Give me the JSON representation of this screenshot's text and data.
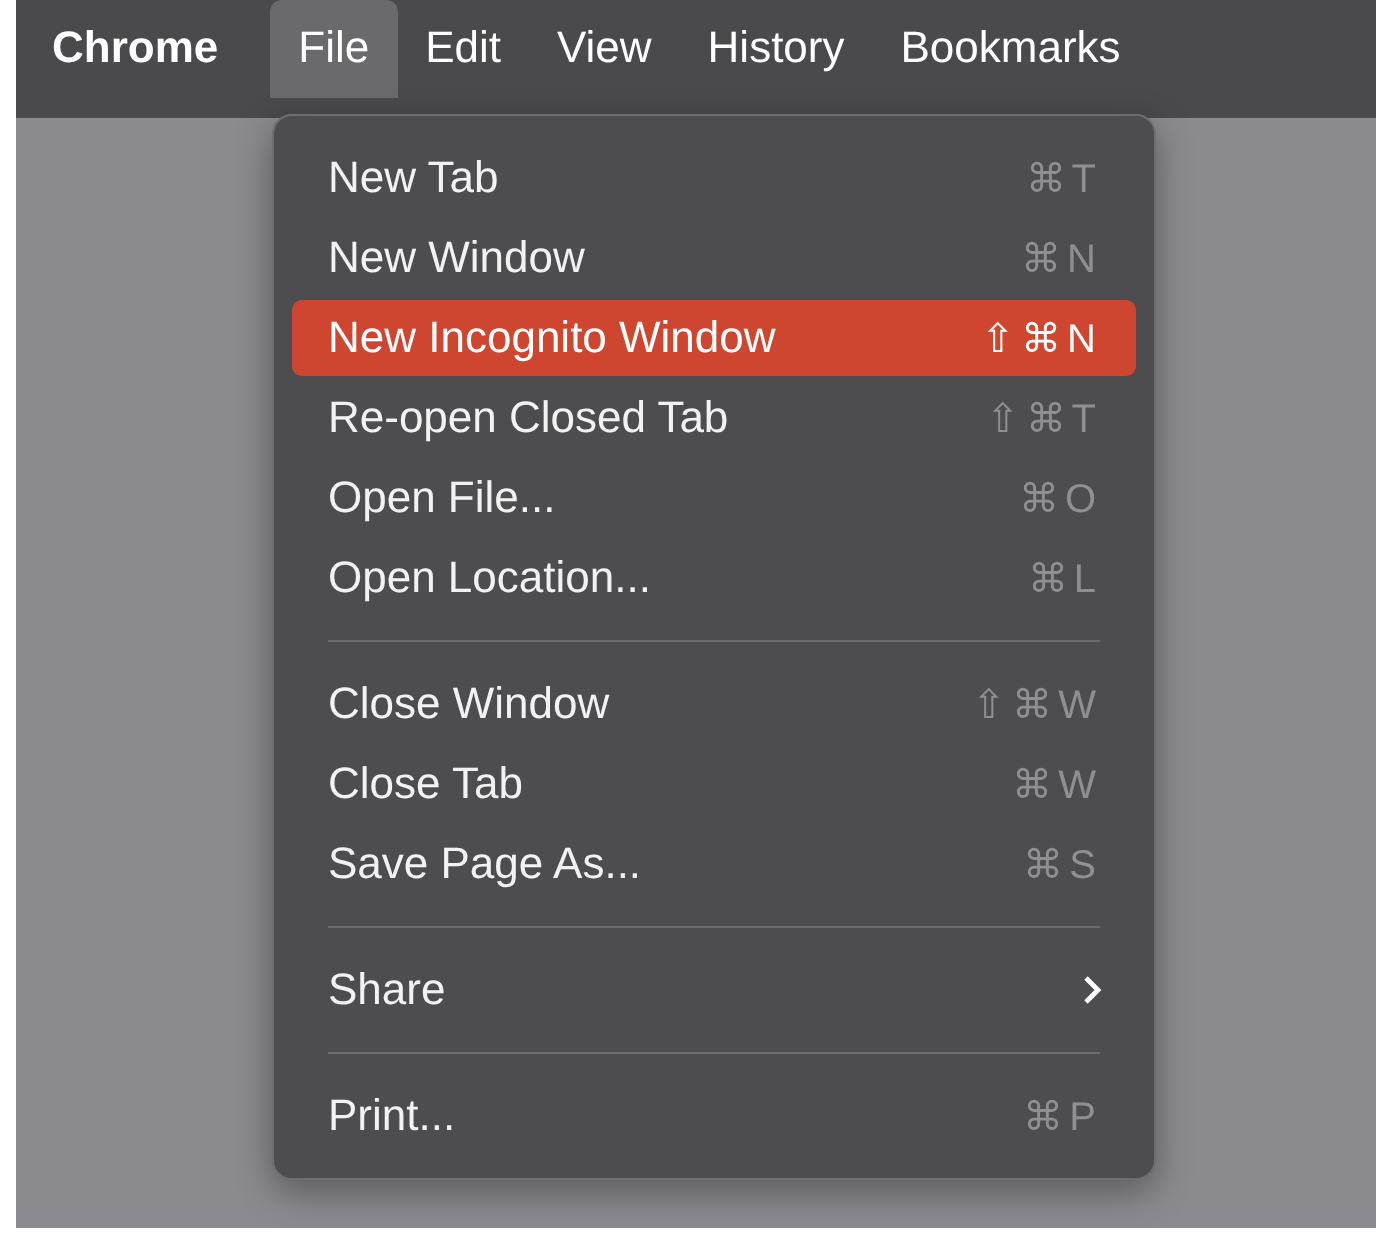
{
  "menu_bar": {
    "items": [
      {
        "label": "Chrome",
        "kind": "app",
        "selected": false
      },
      {
        "label": "File",
        "kind": "menu",
        "selected": true
      },
      {
        "label": "Edit",
        "kind": "menu",
        "selected": false
      },
      {
        "label": "View",
        "kind": "menu",
        "selected": false
      },
      {
        "label": "History",
        "kind": "menu",
        "selected": false
      },
      {
        "label": "Bookmarks",
        "kind": "menu",
        "selected": false
      }
    ]
  },
  "file_menu": {
    "items": [
      {
        "kind": "item",
        "label": "New Tab",
        "shortcut": "⌘T",
        "selected": false
      },
      {
        "kind": "item",
        "label": "New Window",
        "shortcut": "⌘N",
        "selected": false
      },
      {
        "kind": "item",
        "label": "New Incognito Window",
        "shortcut": "⇧⌘N",
        "selected": true
      },
      {
        "kind": "item",
        "label": "Re-open Closed Tab",
        "shortcut": "⇧⌘T",
        "selected": false
      },
      {
        "kind": "item",
        "label": "Open File...",
        "shortcut": "⌘O",
        "selected": false
      },
      {
        "kind": "item",
        "label": "Open Location...",
        "shortcut": "⌘L",
        "selected": false
      },
      {
        "kind": "separator"
      },
      {
        "kind": "item",
        "label": "Close Window",
        "shortcut": "⇧⌘W",
        "selected": false
      },
      {
        "kind": "item",
        "label": "Close Tab",
        "shortcut": "⌘W",
        "selected": false
      },
      {
        "kind": "item",
        "label": "Save Page As...",
        "shortcut": "⌘S",
        "selected": false
      },
      {
        "kind": "separator"
      },
      {
        "kind": "submenu",
        "label": "Share",
        "selected": false
      },
      {
        "kind": "separator"
      },
      {
        "kind": "item",
        "label": "Print...",
        "shortcut": "⌘P",
        "selected": false
      }
    ]
  }
}
